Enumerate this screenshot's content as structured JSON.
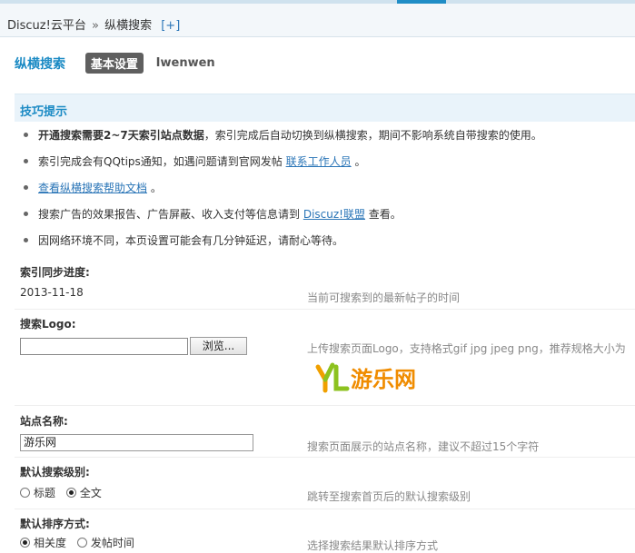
{
  "breadcrumb": {
    "root": "Discuz!云平台",
    "separator": "»",
    "current": "纵横搜索",
    "add": "[+]"
  },
  "subnav": {
    "title": "纵横搜索",
    "active_tab": "基本设置",
    "tab2": "Iwenwen"
  },
  "tips": {
    "heading": "技巧提示",
    "items": [
      {
        "bold": "开通搜索需要2~7天索引站点数据",
        "text": "，索引完成后自动切换到纵横搜索，期间不影响系统自带搜索的使用。"
      },
      {
        "text": "索引完成会有QQtips通知，如遇问题请到官网发帖 ",
        "link": "联系工作人员",
        "after": " 。"
      },
      {
        "link": "查看纵横搜索帮助文档",
        "after": " 。"
      },
      {
        "text": "搜索广告的效果报告、广告屏蔽、收入支付等信息请到  ",
        "link": "Discuz!联盟",
        "after": "  查看。"
      },
      {
        "text": "因网络环境不同，本页设置可能会有几分钟延迟，请耐心等待。"
      }
    ]
  },
  "fields": {
    "index_progress": {
      "label": "索引同步进度:",
      "value": "2013-11-18",
      "hint": "当前可搜索到的最新帖子的时间"
    },
    "search_logo": {
      "label": "搜索Logo:",
      "browse": "浏览...",
      "hint": "上传搜索页面Logo，支持格式gif jpg jpeg png，推荐规格大小为",
      "logo_text": "YL游乐网"
    },
    "site_name": {
      "label": "站点名称:",
      "value": "游乐网",
      "hint": "搜索页面展示的站点名称，建议不超过15个字符"
    },
    "search_level": {
      "label": "默认搜索级别:",
      "options": [
        "标题",
        "全文"
      ],
      "selected": "全文",
      "hint": "跳转至搜索首页后的默认搜索级别"
    },
    "sort_order": {
      "label": "默认排序方式:",
      "options": [
        "相关度",
        "发帖时间"
      ],
      "selected": "相关度",
      "hint": "选择搜索结果默认排序方式"
    }
  },
  "colors": {
    "accent": "#1a8ac4",
    "link": "#2a75b7",
    "tab_bg": "#5f5f5f"
  }
}
